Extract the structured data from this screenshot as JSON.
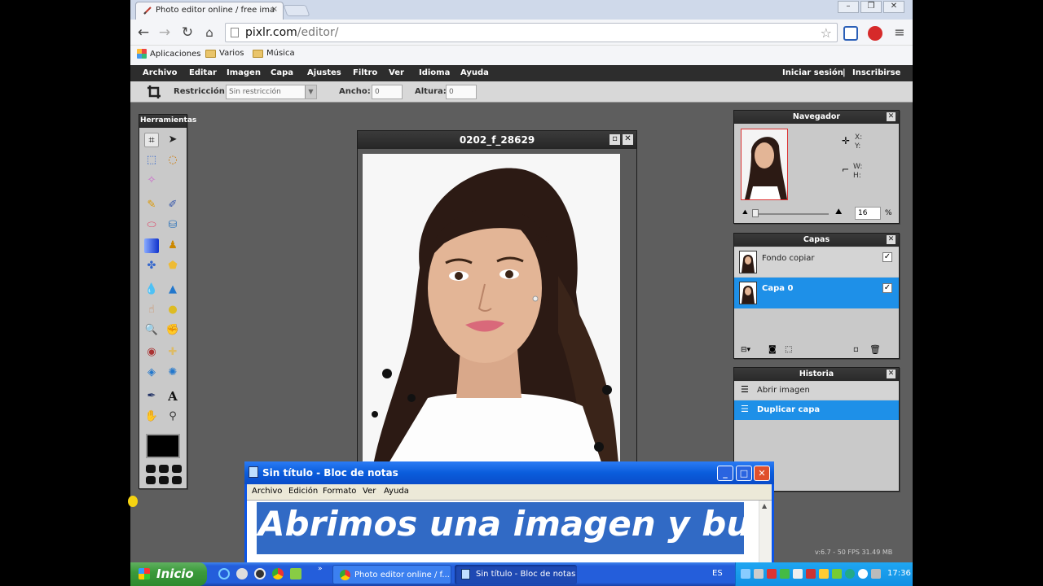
{
  "browser": {
    "tab_title": "Photo editor online / free ima",
    "tab_close": "×",
    "url_host": "pixlr.com",
    "url_path": "/editor/",
    "bookmarks": [
      "Aplicaciones",
      "Varios",
      "Música"
    ],
    "window_controls": [
      "–",
      "❐",
      "✕"
    ]
  },
  "pixlr": {
    "menu": [
      "Archivo",
      "Editar",
      "Imagen",
      "Capa",
      "Ajustes",
      "Filtro",
      "Ver",
      "Idioma",
      "Ayuda"
    ],
    "login": "Iniciar sesión",
    "separator": "|",
    "signup": "Inscribirse",
    "options": {
      "restriction_label": "Restricción:",
      "restriction_value": "Sin restricción",
      "width_label": "Ancho:",
      "width_value": "0",
      "height_label": "Altura:",
      "height_value": "0"
    },
    "tools_title": "Herramientas",
    "document_title": "0202_f_28629",
    "navigator": {
      "title": "Navegador",
      "x_label": "X:",
      "y_label": "Y:",
      "w_label": "W:",
      "h_label": "H:",
      "zoom": "16",
      "zoom_unit": "%"
    },
    "layers": {
      "title": "Capas",
      "items": [
        {
          "name": "Fondo copiar",
          "selected": false,
          "visible": true
        },
        {
          "name": "Capa 0",
          "selected": true,
          "visible": true
        }
      ]
    },
    "history": {
      "title": "Historia",
      "items": [
        {
          "label": "Abrir imagen",
          "selected": false
        },
        {
          "label": "Duplicar capa",
          "selected": true
        }
      ]
    },
    "status": "v:6.7 - 50 FPS 31.49 MB"
  },
  "notepad": {
    "title": "Sin título - Bloc de notas",
    "menu": [
      "Archivo",
      "Edición",
      "Formato",
      "Ver",
      "Ayuda"
    ],
    "text": "Abrimos una imagen y bueno"
  },
  "taskbar": {
    "start": "Inicio",
    "tasks": [
      "Photo editor online / f...",
      "Sin título - Bloc de notas"
    ],
    "lang": "ES",
    "time": "17:36"
  },
  "colors": {
    "accent_select": "#1e90e8",
    "xp_blue": "#245edb"
  }
}
